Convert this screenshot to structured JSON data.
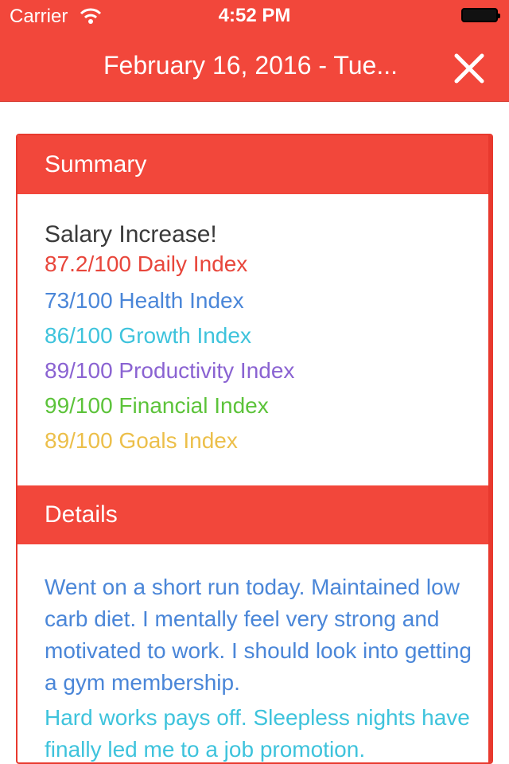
{
  "status_bar": {
    "carrier": "Carrier",
    "time": "4:52 PM"
  },
  "nav": {
    "title": "February 16, 2016 - Tue..."
  },
  "summary": {
    "header": "Summary",
    "headline": "Salary Increase!",
    "indexes": [
      {
        "text": "87.2/100 Daily Index",
        "color": "#e8463b"
      },
      {
        "text": "73/100 Health Index",
        "color": "#4a86d8"
      },
      {
        "text": "86/100 Growth Index",
        "color": "#3ec3dc"
      },
      {
        "text": "89/100 Productivity Index",
        "color": "#8a63d2"
      },
      {
        "text": "99/100 Financial Index",
        "color": "#5cc33a"
      },
      {
        "text": "89/100 Goals Index",
        "color": "#ecbf4a"
      }
    ]
  },
  "details": {
    "header": "Details",
    "paragraphs": [
      {
        "text": "Went on a short run today. Maintained low carb diet. I mentally feel very strong and motivated to work. I should look into getting a gym membership.",
        "color": "#4a86d8"
      },
      {
        "text": "Hard works pays off. Sleepless nights have finally led me to a job promotion.",
        "color": "#3ec3dc"
      }
    ]
  }
}
